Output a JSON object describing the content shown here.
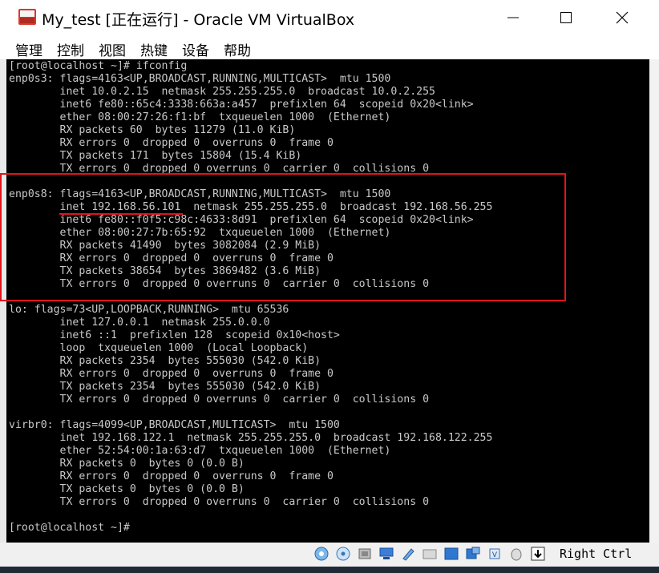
{
  "window": {
    "title": "My_test [正在运行] - Oracle VM VirtualBox"
  },
  "menu": {
    "items": [
      "管理",
      "控制",
      "视图",
      "热键",
      "设备",
      "帮助"
    ]
  },
  "terminal": {
    "lines": [
      "[root@localhost ~]# ifconfig",
      "enp0s3: flags=4163<UP,BROADCAST,RUNNING,MULTICAST>  mtu 1500",
      "        inet 10.0.2.15  netmask 255.255.255.0  broadcast 10.0.2.255",
      "        inet6 fe80::65c4:3338:663a:a457  prefixlen 64  scopeid 0x20<link>",
      "        ether 08:00:27:26:f1:bf  txqueuelen 1000  (Ethernet)",
      "        RX packets 60  bytes 11279 (11.0 KiB)",
      "        RX errors 0  dropped 0  overruns 0  frame 0",
      "        TX packets 171  bytes 15804 (15.4 KiB)",
      "        TX errors 0  dropped 0 overruns 0  carrier 0  collisions 0",
      "",
      "enp0s8: flags=4163<UP,BROADCAST,RUNNING,MULTICAST>  mtu 1500",
      "        inet 192.168.56.101  netmask 255.255.255.0  broadcast 192.168.56.255",
      "        inet6 fe80::f0f5:c98c:4633:8d91  prefixlen 64  scopeid 0x20<link>",
      "        ether 08:00:27:7b:65:92  txqueuelen 1000  (Ethernet)",
      "        RX packets 41490  bytes 3082084 (2.9 MiB)",
      "        RX errors 0  dropped 0  overruns 0  frame 0",
      "        TX packets 38654  bytes 3869482 (3.6 MiB)",
      "        TX errors 0  dropped 0 overruns 0  carrier 0  collisions 0",
      "",
      "lo: flags=73<UP,LOOPBACK,RUNNING>  mtu 65536",
      "        inet 127.0.0.1  netmask 255.0.0.0",
      "        inet6 ::1  prefixlen 128  scopeid 0x10<host>",
      "        loop  txqueuelen 1000  (Local Loopback)",
      "        RX packets 2354  bytes 555030 (542.0 KiB)",
      "        RX errors 0  dropped 0  overruns 0  frame 0",
      "        TX packets 2354  bytes 555030 (542.0 KiB)",
      "        TX errors 0  dropped 0 overruns 0  carrier 0  collisions 0",
      "",
      "virbr0: flags=4099<UP,BROADCAST,MULTICAST>  mtu 1500",
      "        inet 192.168.122.1  netmask 255.255.255.0  broadcast 192.168.122.255",
      "        ether 52:54:00:1a:63:d7  txqueuelen 1000  (Ethernet)",
      "        RX packets 0  bytes 0 (0.0 B)",
      "        RX errors 0  dropped 0  overruns 0  frame 0",
      "        TX packets 0  bytes 0 (0.0 B)",
      "        TX errors 0  dropped 0 overruns 0  carrier 0  collisions 0",
      "",
      "[root@localhost ~]#"
    ]
  },
  "statusbar": {
    "icons": [
      "hard-disk-icon",
      "optical-drive-icon",
      "audio-icon",
      "network-icon",
      "usb-icon",
      "shared-folders-icon",
      "display-icon",
      "video-capture-icon",
      "cpu-icon",
      "mouse-integration-icon",
      "keyboard-capture-icon"
    ],
    "host_key": "Right Ctrl"
  },
  "colors": {
    "highlight": "#e0141e",
    "terminal_bg": "#000000",
    "terminal_fg": "#c8c8c8"
  }
}
